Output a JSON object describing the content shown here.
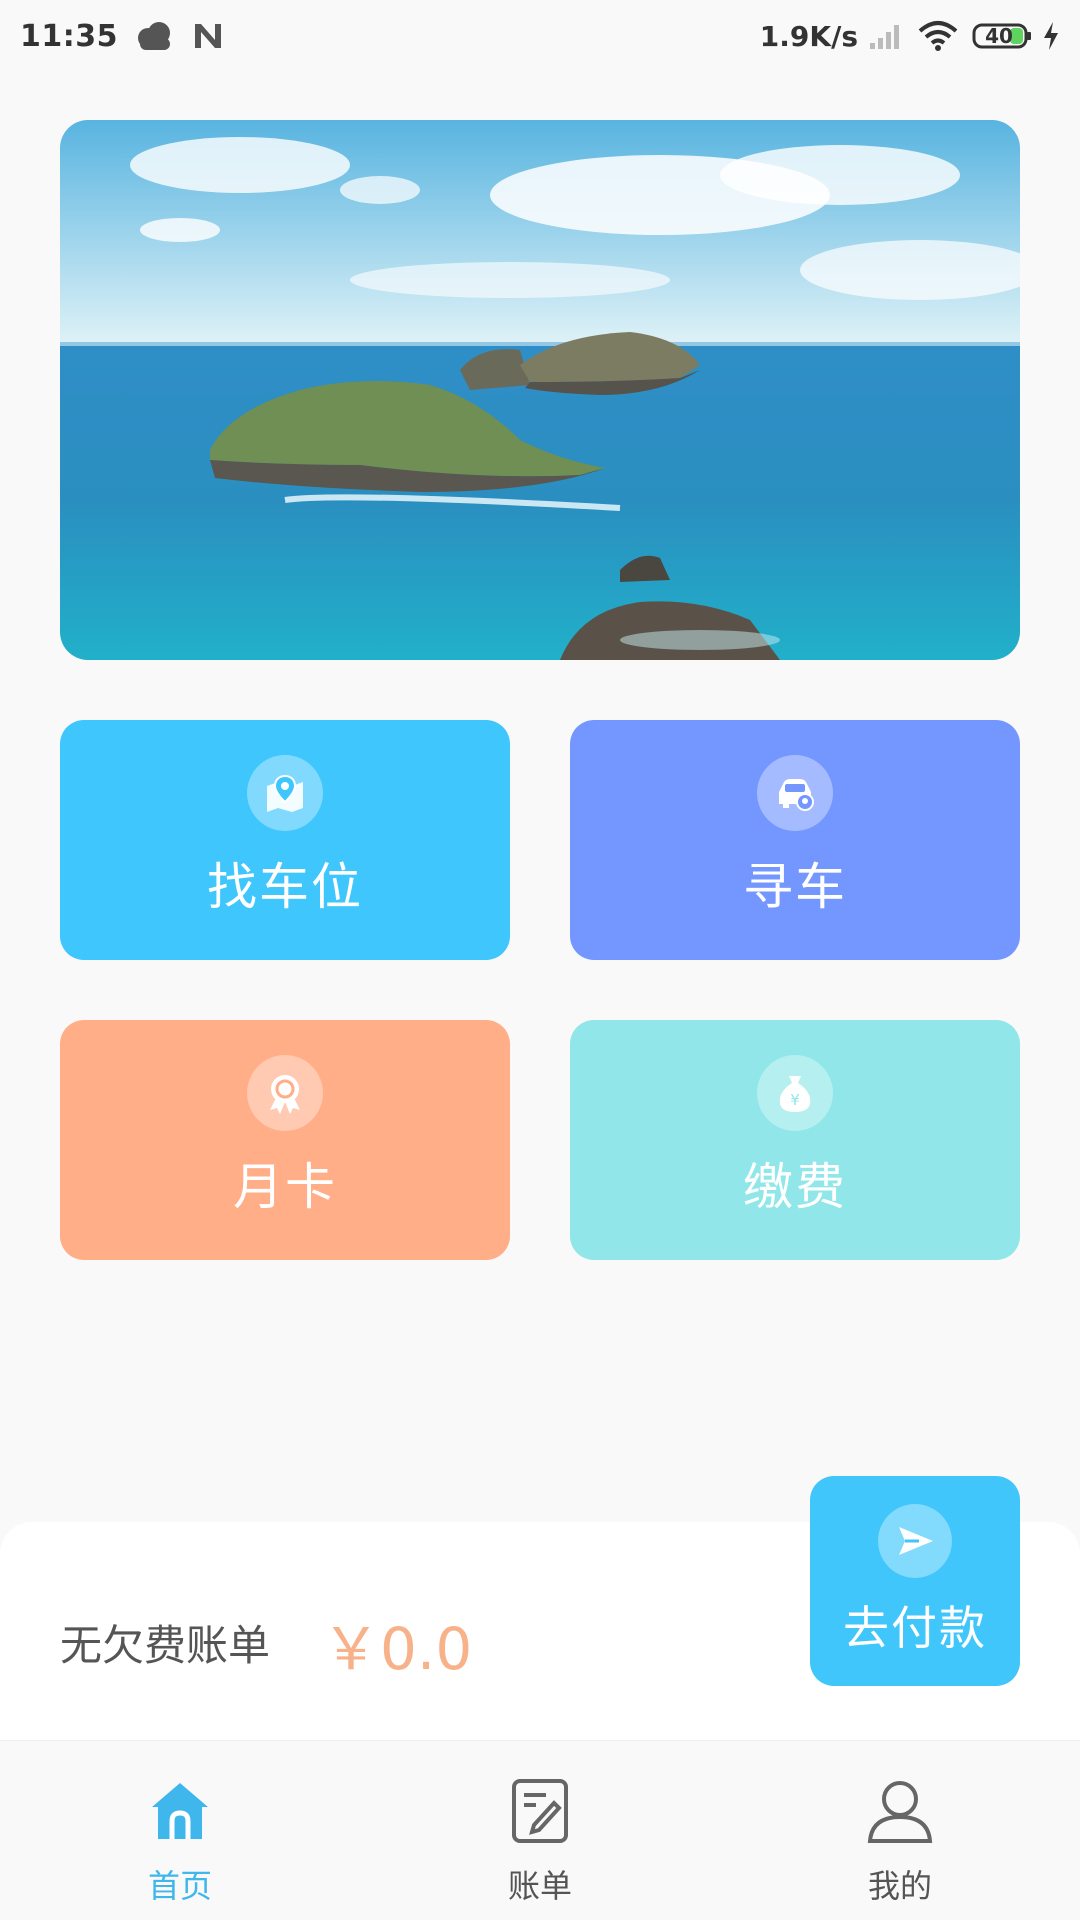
{
  "status_bar": {
    "time": "11:35",
    "network_speed": "1.9K/s",
    "battery": "40",
    "icons": [
      "cloud-icon",
      "n-app-icon",
      "signal-icon",
      "wifi-icon",
      "battery-icon",
      "charging-icon"
    ]
  },
  "banner": {
    "image": "sea-islands-photo"
  },
  "tiles": [
    {
      "label": "找车位",
      "icon": "map-pin-icon",
      "color": "#3ec6fd"
    },
    {
      "label": "寻车",
      "icon": "car-location-icon",
      "color": "#7497ff"
    },
    {
      "label": "月卡",
      "icon": "badge-icon",
      "color": "#ffae87"
    },
    {
      "label": "缴费",
      "icon": "money-bag-icon",
      "color": "#90e6e8"
    }
  ],
  "bill": {
    "status_text": "无欠费账单",
    "amount": "￥0.0",
    "pay_label": "去付款",
    "amount_color": "#f7b28a",
    "pay_color": "#40c6fa"
  },
  "nav": {
    "items": [
      {
        "label": "首页",
        "icon": "home-icon",
        "active": true
      },
      {
        "label": "账单",
        "icon": "bill-edit-icon",
        "active": false
      },
      {
        "label": "我的",
        "icon": "user-icon",
        "active": false
      }
    ],
    "active_color": "#3fb6ec"
  }
}
